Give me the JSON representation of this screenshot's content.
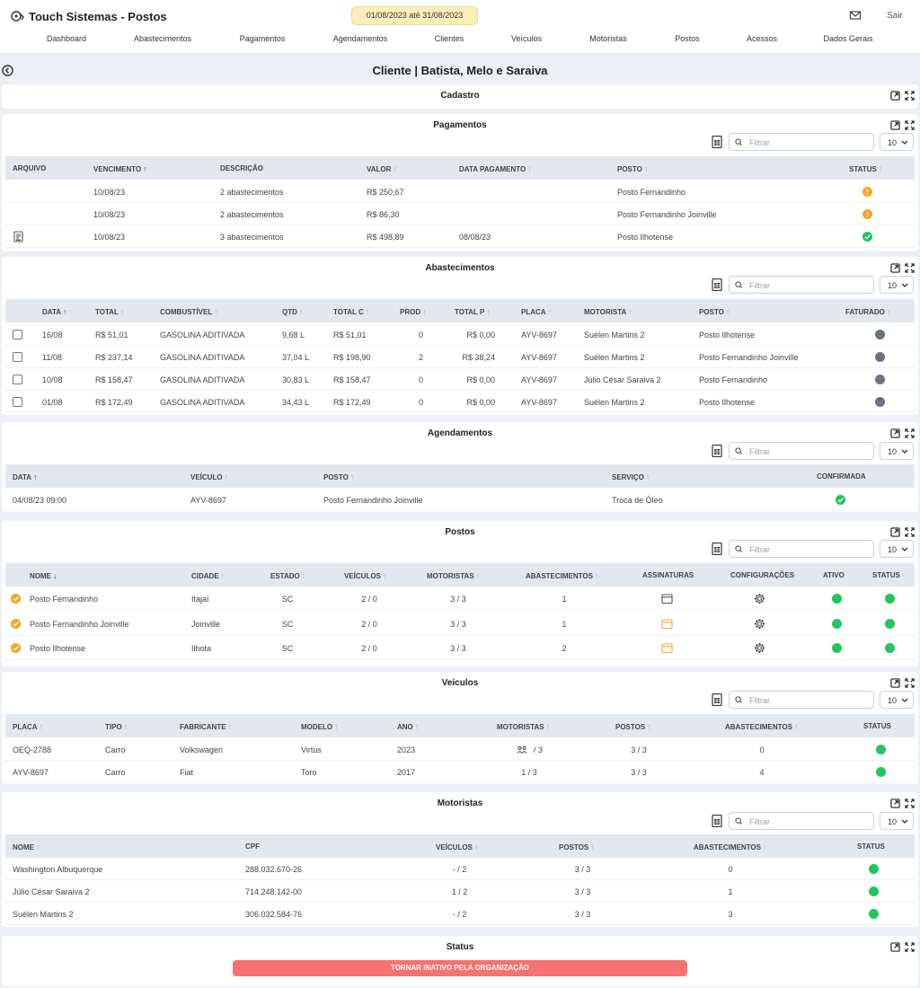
{
  "app": {
    "title": "Touch Sistemas - Postos",
    "date_range": "01/08/2023 até 31/08/2023",
    "logout": "Sair"
  },
  "nav": [
    "Dashboard",
    "Abastecimentos",
    "Pagamentos",
    "Agendamentos",
    "Clientes",
    "Veículos",
    "Motoristas",
    "Postos",
    "Acessos",
    "Dados Gerais"
  ],
  "page_title": "Cliente | Batista, Melo e Saraiva",
  "filter_placeholder": "Filtrar",
  "page_size": "10",
  "colors": {
    "accent": "#22c55e",
    "warning": "#f5a623",
    "danger": "#f87171",
    "header_bg": "#e3e8ef"
  },
  "cadastro": {
    "title": "Cadastro"
  },
  "pagamentos": {
    "title": "Pagamentos",
    "headers": [
      "Arquivo",
      "Vencimento",
      "Descrição",
      "Valor",
      "Data Pagamento",
      "Posto",
      "Status"
    ],
    "rows": [
      {
        "venc": "10/08/23",
        "desc": "2 abastecimentos",
        "valor": "R$ 250,67",
        "data_pag": "",
        "posto": "Posto Fernandinho",
        "status": "pending",
        "arquivo": false
      },
      {
        "venc": "10/08/23",
        "desc": "2 abastecimentos",
        "valor": "R$ 86,30",
        "data_pag": "",
        "posto": "Posto Fernandinho Joinville",
        "status": "pending",
        "arquivo": false
      },
      {
        "venc": "10/08/23",
        "desc": "3 abastecimentos",
        "valor": "R$ 498,89",
        "data_pag": "08/08/23",
        "posto": "Posto Ilhotense",
        "status": "paid",
        "arquivo": true
      }
    ]
  },
  "abastecimentos": {
    "title": "Abastecimentos",
    "headers": [
      "Data",
      "Total",
      "Combustível",
      "Qtd",
      "Total C",
      "Prod",
      "Total P",
      "Placa",
      "Motorista",
      "Posto",
      "Faturado"
    ],
    "rows": [
      [
        "16/08",
        "R$ 51,01",
        "GASOLINA ADITIVADA",
        "9,68 L",
        "R$ 51,01",
        "0",
        "R$ 0,00",
        "AYV-8697",
        "Suélen Martins 2",
        "Posto Ilhotense"
      ],
      [
        "11/08",
        "R$ 237,14",
        "GASOLINA ADITIVADA",
        "37,04 L",
        "R$ 198,90",
        "2",
        "R$ 38,24",
        "AYV-8697",
        "Suélen Martins 2",
        "Posto Fernandinho Joinville"
      ],
      [
        "10/08",
        "R$ 158,47",
        "GASOLINA ADITIVADA",
        "30,83 L",
        "R$ 158,47",
        "0",
        "R$ 0,00",
        "AYV-8697",
        "Júlio César Saraiva 2",
        "Posto Fernandinho"
      ],
      [
        "01/08",
        "R$ 172,49",
        "GASOLINA ADITIVADA",
        "34,43 L",
        "R$ 172,49",
        "0",
        "R$ 0,00",
        "AYV-8697",
        "Suélen Martins 2",
        "Posto Ilhotense"
      ]
    ]
  },
  "agendamentos": {
    "title": "Agendamentos",
    "headers": [
      "Data",
      "Veículo",
      "Posto",
      "Serviço",
      "Confirmada"
    ],
    "rows": [
      [
        "04/08/23 09:00",
        "AYV-8697",
        "Posto Fernandinho Joinville",
        "Troca de Óleo"
      ]
    ]
  },
  "postos": {
    "title": "Postos",
    "headers": [
      "Nome",
      "Cidade",
      "Estado",
      "Veículos",
      "Motoristas",
      "Abastecimentos",
      "Assinaturas",
      "Configurações",
      "Ativo",
      "Status"
    ],
    "rows": [
      [
        "Posto Fernandinho",
        "Itajaí",
        "SC",
        "2 / 0",
        "3 / 3",
        "1"
      ],
      [
        "Posto Fernandinho Joinville",
        "Joinville",
        "SC",
        "2 / 0",
        "3 / 3",
        "1"
      ],
      [
        "Posto Ilhotense",
        "Ilhota",
        "SC",
        "2 / 0",
        "3 / 3",
        "2"
      ]
    ]
  },
  "veiculos": {
    "title": "Veículos",
    "headers": [
      "Placa",
      "Tipo",
      "Fabricante",
      "Modelo",
      "Ano",
      "Motoristas",
      "Postos",
      "Abastecimentos",
      "Status"
    ],
    "rows": [
      [
        "OEQ-2788",
        "Carro",
        "Volkswagen",
        "Virtus",
        "2023",
        "/ 3",
        "3 / 3",
        "0"
      ],
      [
        "AYV-8697",
        "Carro",
        "Fiat",
        "Toro",
        "2017",
        "1 / 3",
        "3 / 3",
        "4"
      ]
    ]
  },
  "motoristas": {
    "title": "Motoristas",
    "headers": [
      "Nome",
      "CPF",
      "Veículos",
      "Postos",
      "Abastecimentos",
      "Status"
    ],
    "rows": [
      [
        "Washington Albuquerque",
        "288.032.670-26",
        "- / 2",
        "3 / 3",
        "0"
      ],
      [
        "Júlio César Saraiva 2",
        "714.248.142-00",
        "1 / 2",
        "3 / 3",
        "1"
      ],
      [
        "Suélen Martins 2",
        "306.032.584-76",
        "- / 2",
        "3 / 3",
        "3"
      ]
    ]
  },
  "status_panel": {
    "title": "Status",
    "button": "TORNAR INATIVO PELA ORGANIZAÇÃO"
  }
}
